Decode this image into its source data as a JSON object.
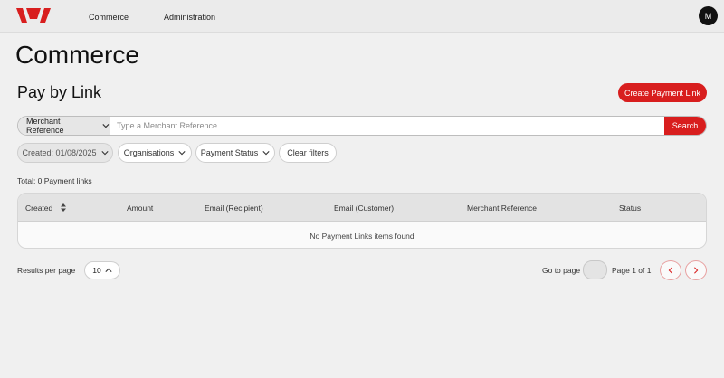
{
  "nav": {
    "items": [
      "Commerce",
      "Administration"
    ],
    "avatar_initial": "M"
  },
  "page": {
    "title": "Commerce",
    "subtitle": "Pay by Link",
    "create_button": "Create Payment Link"
  },
  "search": {
    "field_select": "Merchant Reference",
    "placeholder": "Type a Merchant Reference",
    "value": "",
    "button": "Search"
  },
  "filters": {
    "created": "Created: 01/08/2025",
    "organisations": "Organisations",
    "payment_status": "Payment Status",
    "clear": "Clear filters"
  },
  "summary": {
    "total": "Total: 0 Payment links"
  },
  "table": {
    "headers": [
      "Created",
      "Amount",
      "Email (Recipient)",
      "Email (Customer)",
      "Merchant Reference",
      "Status"
    ],
    "empty_message": "No Payment Links items found"
  },
  "pagination": {
    "results_per_page_label": "Results per page",
    "results_per_page_value": "10",
    "goto_label": "Go to page",
    "page_info": "Page 1 of 1"
  },
  "colors": {
    "brand": "#d81e1e",
    "background": "#f0f0f0"
  },
  "icons": [
    "brand-logo-icon",
    "chevron-down-icon",
    "chevron-up-icon",
    "sort-icon",
    "chevron-left-icon",
    "chevron-right-icon"
  ]
}
